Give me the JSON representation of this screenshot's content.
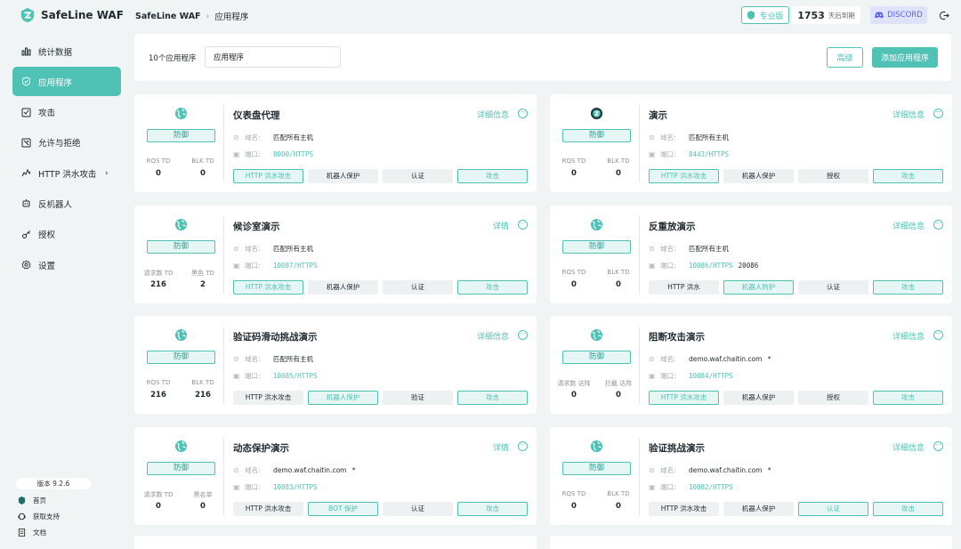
{
  "app": {
    "name": "SafeLine WAF"
  },
  "breadcrumb": {
    "root": "SafeLine WAF",
    "current": "应用程序"
  },
  "sidebar": {
    "items": [
      {
        "label": "统计数据",
        "icon": "bar-chart-icon",
        "active": false
      },
      {
        "label": "应用程序",
        "icon": "shield-icon",
        "active": true
      },
      {
        "label": "攻击",
        "icon": "attack-icon",
        "active": false
      },
      {
        "label": "允许与拒绝",
        "icon": "allow-deny-icon",
        "active": false
      },
      {
        "label": "HTTP 洪水攻击",
        "icon": "flood-icon",
        "active": false,
        "has_chevron": true
      },
      {
        "label": "反机器人",
        "icon": "robot-icon",
        "active": false
      },
      {
        "label": "授权",
        "icon": "key-icon",
        "active": false
      },
      {
        "label": "设置",
        "icon": "gear-icon",
        "active": false
      }
    ],
    "version": "版本 9.2.6",
    "footer": [
      {
        "label": "首页",
        "icon": "home-icon"
      },
      {
        "label": "获取支持",
        "icon": "support-icon"
      },
      {
        "label": "文档",
        "icon": "doc-icon"
      }
    ]
  },
  "header": {
    "pro_label": "专业版",
    "days_count": "1753",
    "days_text": "天后到期",
    "discord_label": "DISCORD"
  },
  "filter": {
    "count_text": "10个应用程序",
    "search_value": "应用程序",
    "advanced_label": "高级",
    "add_label": "添加应用程序"
  },
  "cards": [
    {
      "icon": "globe-icon",
      "mode": "防御",
      "title": "仪表盘代理",
      "detail": "详细信息",
      "stat1_label": "RQS TD",
      "stat1_value": "0",
      "stat2_label": "BLK TD",
      "stat2_value": "0",
      "domain_label": "域名:",
      "domain": "匹配所有主机",
      "domain_extra": "",
      "port_label": "端口:",
      "port": "8000/HTTPS",
      "port_extra": "",
      "tags": [
        {
          "label": "HTTP 洪水攻击",
          "on": true
        },
        {
          "label": "机器人保护",
          "on": false
        },
        {
          "label": "认证",
          "on": false
        },
        {
          "label": "攻击",
          "on": true
        }
      ]
    },
    {
      "icon": "safeline-icon",
      "mode": "防御",
      "title": "演示",
      "detail": "详细信息",
      "stat1_label": "RQS TD",
      "stat1_value": "0",
      "stat2_label": "BLK TD",
      "stat2_value": "0",
      "domain_label": "域名:",
      "domain": "匹配所有主机",
      "domain_extra": "",
      "port_label": "端口:",
      "port": "8443/HTTPS",
      "port_extra": "",
      "tags": [
        {
          "label": "HTTP 洪水攻击",
          "on": true
        },
        {
          "label": "机器人保护",
          "on": false
        },
        {
          "label": "授权",
          "on": false
        },
        {
          "label": "攻击",
          "on": true
        }
      ]
    },
    {
      "icon": "globe-icon",
      "mode": "防御",
      "title": "候诊室演示",
      "detail": "详情",
      "stat1_label": "请求数 TD",
      "stat1_value": "216",
      "stat2_label": "黑色 TD",
      "stat2_value": "2",
      "domain_label": "域名:",
      "domain": "匹配所有主机",
      "domain_extra": "",
      "port_label": "端口:",
      "port": "10087/HTTPS",
      "port_extra": "",
      "tags": [
        {
          "label": "HTTP 洪水攻击",
          "on": true
        },
        {
          "label": "机器人保护",
          "on": false
        },
        {
          "label": "认证",
          "on": false
        },
        {
          "label": "攻击",
          "on": true
        }
      ]
    },
    {
      "icon": "globe-icon",
      "mode": "防御",
      "title": "反重放演示",
      "detail": "详细信息",
      "stat1_label": "RQS TD",
      "stat1_value": "0",
      "stat2_label": "BLK TD",
      "stat2_value": "0",
      "domain_label": "域名:",
      "domain": "匹配所有主机",
      "domain_extra": "",
      "port_label": "端口:",
      "port": "10086/HTTPS",
      "port_extra": "20086",
      "tags": [
        {
          "label": "HTTP 洪水",
          "on": false
        },
        {
          "label": "机器人防护",
          "on": true
        },
        {
          "label": "认证",
          "on": false
        },
        {
          "label": "攻击",
          "on": true
        }
      ]
    },
    {
      "icon": "globe-icon",
      "mode": "防御",
      "title": "验证码滑动挑战演示",
      "detail": "详细信息",
      "stat1_label": "RQS TD",
      "stat1_value": "216",
      "stat2_label": "BLK TD",
      "stat2_value": "216",
      "domain_label": "域名:",
      "domain": "匹配所有主机",
      "domain_extra": "",
      "port_label": "端口:",
      "port": "10085/HTTPS",
      "port_extra": "",
      "tags": [
        {
          "label": "HTTP 洪水攻击",
          "on": false
        },
        {
          "label": "机器人保护",
          "on": true
        },
        {
          "label": "验证",
          "on": false
        },
        {
          "label": "攻击",
          "on": true
        }
      ]
    },
    {
      "icon": "globe-icon",
      "mode": "防御",
      "title": "阻断攻击演示",
      "detail": "详细信息",
      "stat1_label": "请求数 达阵",
      "stat1_value": "0",
      "stat2_label": "拦截 达阵",
      "stat2_value": "0",
      "domain_label": "域名:",
      "domain": "demo.waf.chaitin.com",
      "domain_extra": "*",
      "port_label": "端口:",
      "port": "10084/HTTPS",
      "port_extra": "",
      "tags": [
        {
          "label": "HTTP 洪水攻击",
          "on": true
        },
        {
          "label": "机器人保护",
          "on": false
        },
        {
          "label": "授权",
          "on": false
        },
        {
          "label": "攻击",
          "on": true
        }
      ]
    },
    {
      "icon": "globe-icon",
      "mode": "防御",
      "title": "动态保护演示",
      "detail": "详情",
      "stat1_label": "请求数 TD",
      "stat1_value": "0",
      "stat2_label": "黑名单",
      "stat2_value": "0",
      "domain_label": "域名:",
      "domain": "demo.waf.chaitin.com",
      "domain_extra": "*",
      "port_label": "端口:",
      "port": "10083/HTTPS",
      "port_extra": "",
      "tags": [
        {
          "label": "HTTP 洪水攻击",
          "on": false
        },
        {
          "label": "BOT 保护",
          "on": true
        },
        {
          "label": "认证",
          "on": false
        },
        {
          "label": "攻击",
          "on": true
        }
      ]
    },
    {
      "icon": "globe-icon",
      "mode": "防御",
      "title": "验证挑战演示",
      "detail": "详细信息",
      "stat1_label": "RQS TD",
      "stat1_value": "0",
      "stat2_label": "BLK TD",
      "stat2_value": "0",
      "domain_label": "域名:",
      "domain": "demo.waf.chaitin.com",
      "domain_extra": "*",
      "port_label": "端口:",
      "port": "10082/HTTPS",
      "port_extra": "",
      "tags": [
        {
          "label": "HTTP 洪水攻击",
          "on": false
        },
        {
          "label": "机器人保护",
          "on": false
        },
        {
          "label": "认证",
          "on": true
        },
        {
          "label": "攻击",
          "on": true
        }
      ]
    }
  ],
  "colors": {
    "accent": "#4fc1b5",
    "accent_light": "#e6f6f4",
    "discord": "#5865f2",
    "background": "#f1f4f5"
  }
}
